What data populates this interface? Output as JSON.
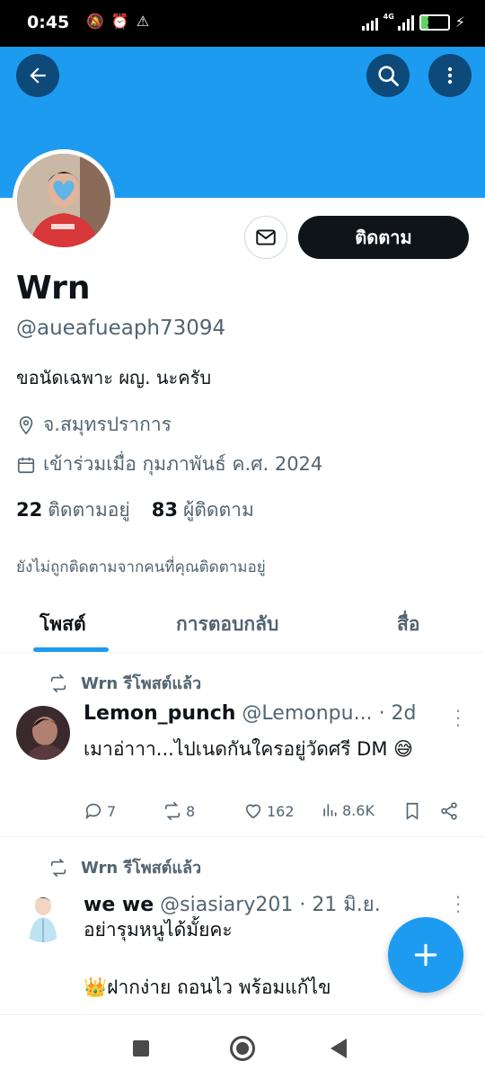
{
  "status_bar": {
    "time": "0:45",
    "network": "4G",
    "battery": "26",
    "battery_level": 0.26
  },
  "header": {
    "back_icon": "arrow-left-icon",
    "search_icon": "search-icon",
    "more_icon": "more-vertical-icon",
    "banner_color": "#1d9bf0"
  },
  "profile": {
    "display_name": "Wrn",
    "handle": "@aueafueaph73094",
    "bio": "ขอนัดเฉพาะ ผญ. นะครับ",
    "location": "จ.สมุทรปราการ",
    "joined": "เข้าร่วมเมื่อ กุมภาพันธ์ ค.ศ. 2024",
    "following_count": "22",
    "following_label": "ติดตามอยู่",
    "followers_count": "83",
    "followers_label": "ผู้ติดตาม",
    "not_followed_note": "ยังไม่ถูกติดตามจากคนที่คุณติดตามอยู่",
    "follow_button": "ติดตาม",
    "message_icon": "mail-icon"
  },
  "tabs": [
    {
      "label": "โพสต์",
      "active": true
    },
    {
      "label": "การตอบกลับ",
      "active": false
    },
    {
      "label": "สื่อ",
      "active": false
    }
  ],
  "tweets": [
    {
      "repost_label": "Wrn รีโพสต์แล้ว",
      "author_name": "Lemon_punch",
      "author_handle": "@Lemonpu...",
      "time": "· 2d",
      "text": "เมาอ่าาา...ไปเนดกันใครอยู่วัดศรี DM 😅",
      "replies": "7",
      "reposts": "8",
      "likes": "162",
      "views": "8.6K"
    },
    {
      "repost_label": "Wrn รีโพสต์แล้ว",
      "author_name": "we we",
      "author_handle": "@siasiary201",
      "time": "· 21 มิ.ย.",
      "text": "อย่ารุมหนูได้มั้ยคะ\n\n👑ฝากง่าย ถอนไว พร้อมแก้ไข"
    }
  ],
  "fab": {
    "icon": "plus-icon"
  },
  "accent_color": "#1d9bf0"
}
